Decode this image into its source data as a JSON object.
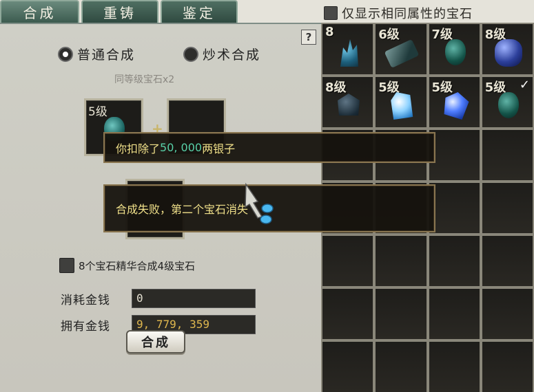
{
  "tabs": [
    {
      "label": "合成",
      "active": true
    },
    {
      "label": "重铸",
      "active": false
    },
    {
      "label": "鉴定",
      "active": false
    }
  ],
  "filter": {
    "label": "仅显示相同属性的宝石",
    "checked": false
  },
  "help": {
    "label": "?"
  },
  "modes": [
    {
      "label": "普通合成",
      "selected": true
    },
    {
      "label": "炒术合成",
      "selected": false
    }
  ],
  "hint": "同等级宝石x2",
  "slots": [
    {
      "level": "5级",
      "filled": true
    },
    {
      "level": "",
      "filled": false
    }
  ],
  "plus": "+",
  "essence": {
    "label": "8个宝石精华合成4级宝石",
    "checked": false
  },
  "cost": {
    "label": "消耗金钱",
    "value": "0"
  },
  "owned": {
    "label": "拥有金钱",
    "value": "9, 779, 359"
  },
  "combine_button": "合成",
  "messages": {
    "deducted_prefix": "你扣除了",
    "deducted_amount": "50, 000",
    "deducted_suffix": "两银子",
    "fail_text": "合成失败，第二个宝石消失"
  },
  "inventory": [
    {
      "level": "8",
      "gem": "crystal-icon"
    },
    {
      "level": "6级",
      "gem": "flat-gem-icon"
    },
    {
      "level": "7级",
      "gem": "green-egg-gem-icon"
    },
    {
      "level": "8级",
      "gem": "blue-gem-icon"
    },
    {
      "level": "8级",
      "gem": "dark-gem-icon"
    },
    {
      "level": "5级",
      "gem": "ice-gem-icon"
    },
    {
      "level": "5级",
      "gem": "sapphire-gem-icon"
    },
    {
      "level": "5级",
      "gem": "green-egg-gem-icon",
      "selected": true
    }
  ],
  "colors": {
    "money": "#e0b84e",
    "message_text": "#f0e08a",
    "amount": "#58d0a8"
  }
}
